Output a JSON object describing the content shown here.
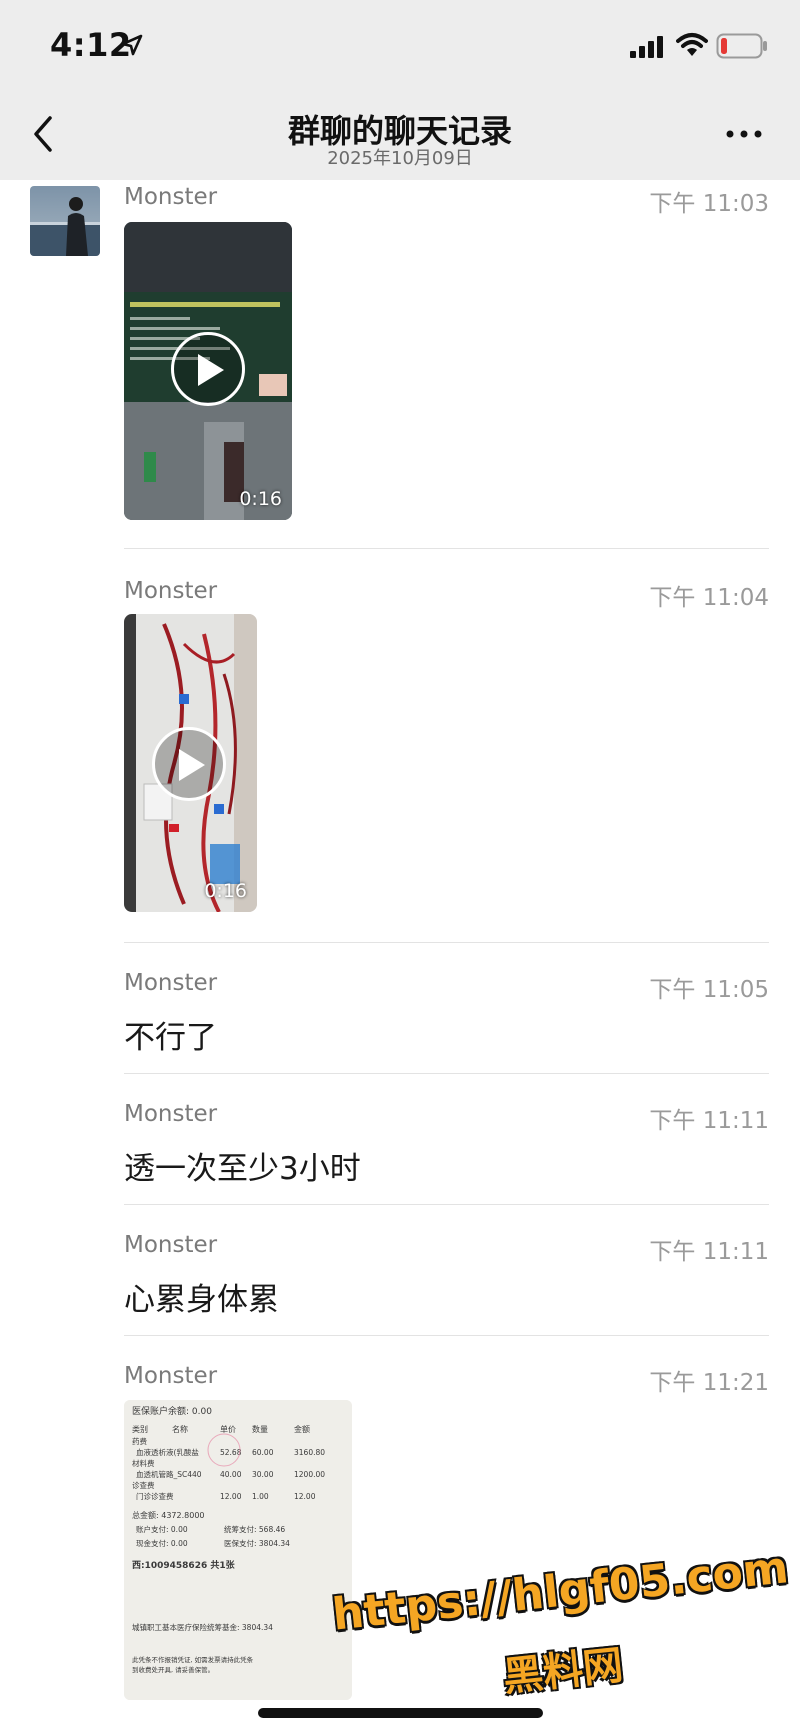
{
  "status_bar": {
    "time": "4:12"
  },
  "header": {
    "title": "群聊的聊天记录",
    "date": "2025年10月09日"
  },
  "messages": [
    {
      "sender": "Monster",
      "time": "下午 11:03",
      "type": "video",
      "duration": "0:16"
    },
    {
      "sender": "Monster",
      "time": "下午 11:04",
      "type": "video",
      "duration": "0:16"
    },
    {
      "sender": "Monster",
      "time": "下午 11:05",
      "type": "text",
      "text": "不行了"
    },
    {
      "sender": "Monster",
      "time": "下午 11:11",
      "type": "text",
      "text": "透一次至少3小时"
    },
    {
      "sender": "Monster",
      "time": "下午 11:11",
      "type": "text",
      "text": "心累身体累"
    },
    {
      "sender": "Monster",
      "time": "下午 11:21",
      "type": "image"
    }
  ],
  "receipt": {
    "line1": "医保账户余额: 0.00",
    "headers": [
      "类别",
      "名称",
      "单价",
      "数量",
      "金额"
    ],
    "rows": [
      [
        "药费",
        "",
        "",
        "",
        ""
      ],
      [
        "",
        "血液透析液(乳酸盐",
        "52.68",
        "60.00",
        "3160.80"
      ],
      [
        "材料费",
        "",
        "",
        "",
        ""
      ],
      [
        "",
        "血透机管路_SC440",
        "40.00",
        "30.00",
        "1200.00"
      ],
      [
        "诊查费",
        "",
        "",
        "",
        ""
      ],
      [
        "",
        "门诊诊查费",
        "12.00",
        "1.00",
        "12.00"
      ]
    ],
    "total": "总金额: 4372.8000",
    "personal_account": "账户支付: 0.00",
    "cash_pay": "现金支付: 0.00",
    "pooled_pay": "统筹支付: 568.46",
    "insurance_pay": "医保支付: 3804.34",
    "serial": "西:1009458626  共1张",
    "fund": "城镇职工基本医疗保险统筹基金: 3804.34",
    "footer": "此凭条不作报销凭证, 如需发票请持此凭条到收费处开具, 请妥善保管。"
  },
  "watermark": {
    "url": "https://hlgf05.com",
    "name": "黑料网"
  },
  "colors": {
    "nav_bg": "#ededed",
    "watermark": "#f5a623"
  }
}
